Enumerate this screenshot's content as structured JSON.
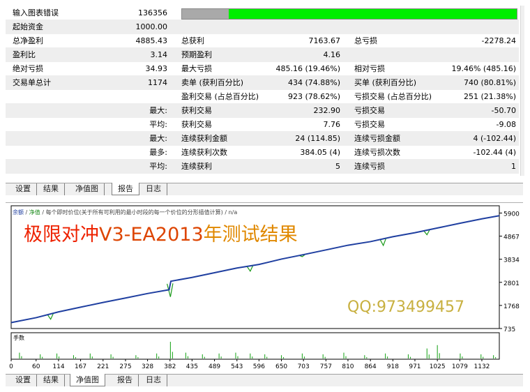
{
  "report": {
    "rows": [
      {
        "cells": [
          {
            "label": "输入图表错误",
            "value": "136356"
          }
        ]
      },
      {
        "cells": [
          {
            "label": "起始资金",
            "value": "1000.00"
          }
        ]
      },
      {
        "cells": [
          {
            "label": "总净盈利",
            "value": "4885.43"
          },
          {
            "label": "总获利",
            "value": "7163.67"
          },
          {
            "label": "总亏损",
            "value": "-2278.24"
          }
        ]
      },
      {
        "cells": [
          {
            "label": "盈利比",
            "value": "3.14"
          },
          {
            "label": "预期盈利",
            "value": "4.16"
          }
        ]
      },
      {
        "cells": [
          {
            "label": "绝对亏损",
            "value": "34.93"
          },
          {
            "label": "最大亏损",
            "value": "485.16 (19.46%)"
          },
          {
            "label": "相对亏损",
            "value": "19.46% (485.16)"
          }
        ]
      },
      {
        "cells": [
          {
            "label": "交易单总计",
            "value": "1174"
          },
          {
            "label": "卖单 (获利百分比)",
            "value": "434 (74.88%)"
          },
          {
            "label": "买单 (获利百分比)",
            "value": "740 (80.81%)"
          }
        ]
      },
      {
        "cells": [
          {
            "label": "",
            "value": ""
          },
          {
            "label": "盈利交易 (占总百分比)",
            "value": "923 (78.62%)"
          },
          {
            "label": "亏损交易 (占总百分比)",
            "value": "251 (21.38%)"
          }
        ]
      },
      {
        "cells": [
          {
            "label": "",
            "value": "最大:"
          },
          {
            "label": "获利交易",
            "value": "232.90"
          },
          {
            "label": "亏损交易",
            "value": "-50.70"
          }
        ]
      },
      {
        "cells": [
          {
            "label": "",
            "value": "平均:"
          },
          {
            "label": "获利交易",
            "value": "7.76"
          },
          {
            "label": "亏损交易",
            "value": "-9.08"
          }
        ]
      },
      {
        "cells": [
          {
            "label": "",
            "value": "最大:"
          },
          {
            "label": "连续获利金额",
            "value": "24 (114.85)"
          },
          {
            "label": "连续亏损金额",
            "value": "4 (-102.44)"
          }
        ]
      },
      {
        "cells": [
          {
            "label": "",
            "value": "最多:"
          },
          {
            "label": "连续获利次数",
            "value": "384.05 (4)"
          },
          {
            "label": "连续亏损次数",
            "value": "-102.44 (4)"
          }
        ]
      },
      {
        "cells": [
          {
            "label": "",
            "value": "平均:"
          },
          {
            "label": "连续获利",
            "value": "5"
          },
          {
            "label": "连续亏损",
            "value": "1"
          }
        ]
      }
    ],
    "quality_bar": {
      "gray_fraction": 0.14,
      "green_color": "#00ee00",
      "gray_color": "#a9a9a9"
    }
  },
  "tabs_top": [
    {
      "label": "设置",
      "active": false
    },
    {
      "label": "结果",
      "active": false
    },
    {
      "label": "净值图",
      "active": false
    },
    {
      "label": "报告",
      "active": true
    },
    {
      "label": "日志",
      "active": false
    }
  ],
  "tabs_bottom": [
    {
      "label": "设置",
      "active": false
    },
    {
      "label": "结果",
      "active": false
    },
    {
      "label": "净值图",
      "active": true
    },
    {
      "label": "报告",
      "active": false
    },
    {
      "label": "日志",
      "active": false
    }
  ],
  "chart_data": {
    "type": "line",
    "legend_text": [
      "余额",
      " / ",
      "净值",
      " / 每个即时价位(关于所有可利用的最小时段的每一个价位的分形插值计算) / n/a"
    ],
    "legend_colors": [
      "#1f3fa0",
      "#444444",
      "#1a8a1a",
      "#444444"
    ],
    "overlay_title": {
      "part1": "极限对冲",
      "part2": "V3-EA2013",
      "part3": "年测试结果",
      "color1": "#ee2200",
      "color2": "#dd4400",
      "color3": "#e08800"
    },
    "overlay_qq": "QQ:973499457",
    "overlay_qq_color": "#c8b040",
    "lower_pane_label": "手数",
    "y_ticks": [
      5900,
      4867,
      3834,
      2801,
      1768,
      735
    ],
    "x_ticks": [
      0,
      60,
      114,
      167,
      221,
      275,
      328,
      382,
      435,
      489,
      543,
      596,
      650,
      703,
      757,
      810,
      864,
      918,
      971,
      1025,
      1079,
      1132
    ],
    "xlim": [
      0,
      1174
    ],
    "ylim": [
      735,
      6100
    ],
    "balance_color": "#1f3fa0",
    "equity_color": "#1a9a1a",
    "balance_series": {
      "name": "余额",
      "x": [
        0,
        60,
        114,
        167,
        221,
        275,
        328,
        380,
        384,
        435,
        489,
        543,
        596,
        650,
        703,
        757,
        810,
        864,
        918,
        971,
        1025,
        1079,
        1132,
        1174
      ],
      "y": [
        1000,
        1220,
        1480,
        1690,
        1900,
        2100,
        2300,
        2470,
        2850,
        3020,
        3230,
        3440,
        3600,
        3840,
        4040,
        4250,
        4460,
        4620,
        4840,
        5020,
        5230,
        5440,
        5640,
        5780
      ]
    },
    "equity_dips": [
      {
        "x": 95,
        "y": 1150
      },
      {
        "x": 383,
        "y": 2150
      },
      {
        "x": 575,
        "y": 3300
      },
      {
        "x": 700,
        "y": 3950
      },
      {
        "x": 895,
        "y": 4450
      },
      {
        "x": 1000,
        "y": 4930
      }
    ],
    "lots_spikes": [
      {
        "x": 20,
        "v": 0.35
      },
      {
        "x": 70,
        "v": 0.25
      },
      {
        "x": 110,
        "v": 0.3
      },
      {
        "x": 150,
        "v": 0.2
      },
      {
        "x": 190,
        "v": 0.3
      },
      {
        "x": 240,
        "v": 0.25
      },
      {
        "x": 300,
        "v": 0.2
      },
      {
        "x": 350,
        "v": 0.3
      },
      {
        "x": 383,
        "v": 1.0
      },
      {
        "x": 420,
        "v": 0.35
      },
      {
        "x": 460,
        "v": 0.25
      },
      {
        "x": 500,
        "v": 0.3
      },
      {
        "x": 540,
        "v": 0.35
      },
      {
        "x": 575,
        "v": 0.3
      },
      {
        "x": 610,
        "v": 0.25
      },
      {
        "x": 650,
        "v": 0.2
      },
      {
        "x": 700,
        "v": 0.3
      },
      {
        "x": 750,
        "v": 0.25
      },
      {
        "x": 800,
        "v": 0.35
      },
      {
        "x": 850,
        "v": 0.2
      },
      {
        "x": 900,
        "v": 0.3
      },
      {
        "x": 955,
        "v": 0.25
      },
      {
        "x": 1000,
        "v": 0.6
      },
      {
        "x": 1025,
        "v": 0.8
      },
      {
        "x": 1080,
        "v": 0.3
      },
      {
        "x": 1130,
        "v": 0.25
      },
      {
        "x": 1160,
        "v": 0.2
      }
    ]
  }
}
